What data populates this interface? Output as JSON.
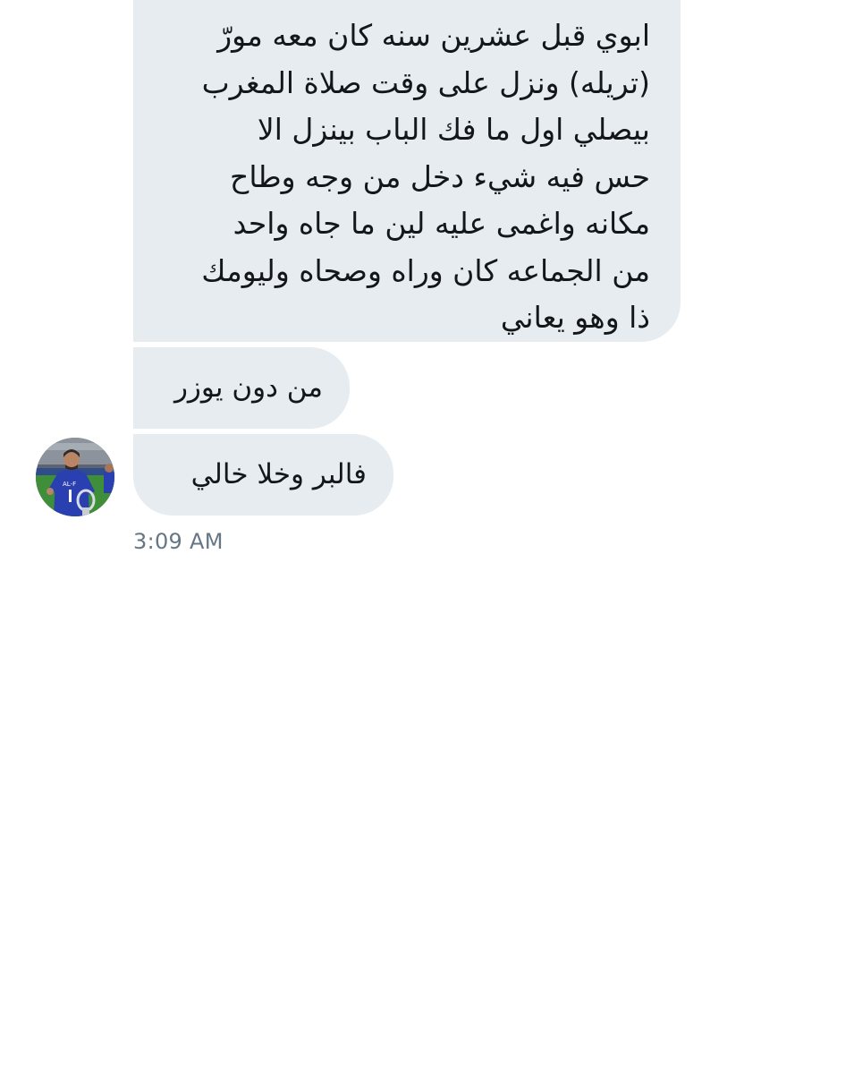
{
  "conversation": {
    "messages": [
      {
        "text": "ابوي قبل عشرين سنه كان معه مورّ\n(تريله) ونزل على وقت صلاة المغرب\nبيصلي اول ما فك الباب بينزل الا\nحس فيه شيء دخل من وجه وطاح\nمكانه واغمى عليه لين ما جاه واحد\nمن الجماعه كان وراه وصحاه وليومك\nذا وهو يعاني"
      },
      {
        "text": "من دون يوزر"
      },
      {
        "text": "فالبر وخلا خالي"
      }
    ],
    "timestamp": "3:09 AM",
    "sender_avatar": {
      "icon": "profile-photo-icon",
      "jersey_color": "#2a3fb0",
      "field_color": "#3f8f3a"
    }
  },
  "colors": {
    "bubble_background": "#e6ecf0",
    "message_text": "#14171a",
    "timestamp_text": "#657786"
  }
}
